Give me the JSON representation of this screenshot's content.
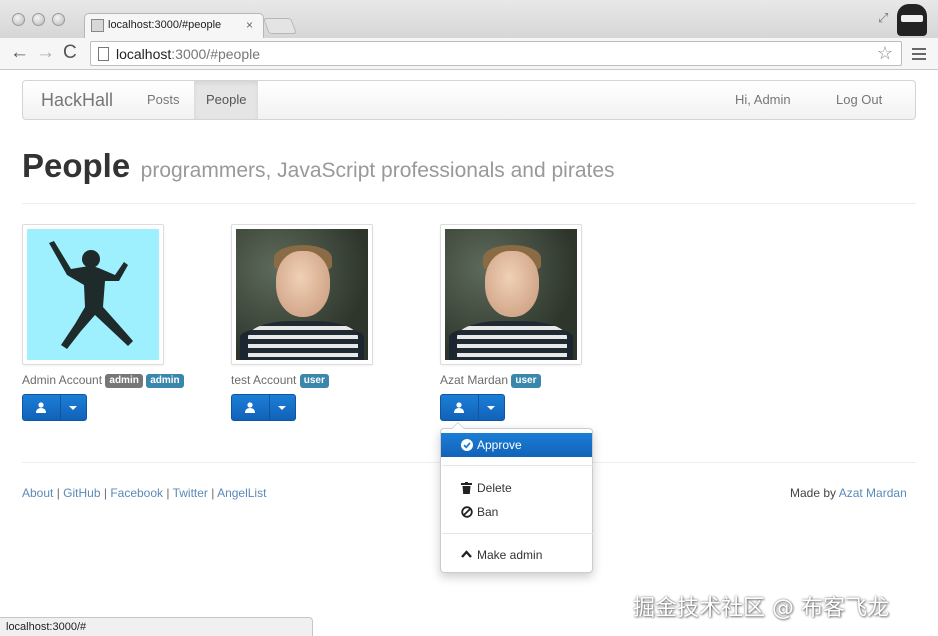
{
  "browser": {
    "tab_title": "localhost:3000/#people",
    "tab_close": "×",
    "url_host": "localhost",
    "url_rest": ":3000/#people",
    "status_url": "localhost:3000/#"
  },
  "navbar": {
    "brand": "HackHall",
    "links": [
      "Posts",
      "People"
    ],
    "active_link": "People",
    "greeting": "Hi, Admin",
    "logout": "Log Out"
  },
  "header": {
    "title": "People",
    "subtitle": "programmers, JavaScript professionals and pirates"
  },
  "people": [
    {
      "name": "Admin Account",
      "badges": [
        {
          "text": "admin",
          "color": "#777777"
        },
        {
          "text": "admin",
          "color": "#3a87ad"
        }
      ],
      "photo": "jumping-silhouette"
    },
    {
      "name": "test Account",
      "badges": [
        {
          "text": "user",
          "color": "#3a87ad"
        }
      ],
      "photo": "portrait"
    },
    {
      "name": "Azat Mardan",
      "badges": [
        {
          "text": "user",
          "color": "#3a87ad"
        }
      ],
      "photo": "portrait"
    }
  ],
  "dropdown": {
    "approve": "Approve",
    "delete": "Delete",
    "ban": "Ban",
    "make_admin": "Make admin"
  },
  "footer": {
    "links": [
      "About",
      "GitHub",
      "Facebook",
      "Twitter",
      "AngelList"
    ],
    "separator": " | ",
    "made_by_prefix": "Made by ",
    "made_by_name": "Azat Mardan"
  },
  "watermark": "掘金技术社区 @ 布客飞龙",
  "colors": {
    "primary": "#1c7ed6",
    "label_gray": "#777777",
    "label_blue": "#3a87ad",
    "link": "#5a8ab8"
  },
  "icons": [
    "back-arrow-icon",
    "forward-arrow-icon",
    "reload-icon",
    "page-icon",
    "star-icon",
    "menu-icon",
    "user-icon",
    "caret-down-icon",
    "check-circle-icon",
    "trash-icon",
    "ban-icon",
    "chevron-up-icon"
  ]
}
